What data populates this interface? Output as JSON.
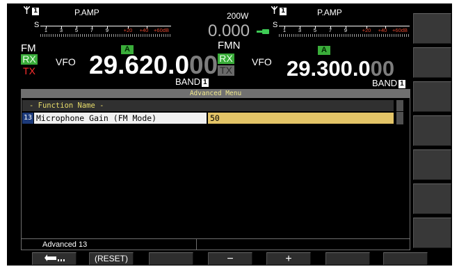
{
  "meter_left": {
    "antenna_number": "1",
    "pamp": "P.AMP",
    "s_letter": "S",
    "scale_labels": [
      "1",
      "3",
      "5",
      "7",
      "9",
      "+20",
      "+40",
      "+60dB"
    ]
  },
  "meter_right": {
    "antenna_number": "1",
    "pamp": "P.AMP",
    "s_letter": "S",
    "scale_labels": [
      "1",
      "3",
      "5",
      "7",
      "9",
      "+20",
      "+40",
      "+60dB"
    ]
  },
  "power": {
    "label": "200W",
    "value": "0.000"
  },
  "vfo_main": {
    "mode": "FM",
    "rx": "RX",
    "tx": "TX",
    "vfo_label": "VFO",
    "a_badge": "A",
    "freq_main": "29.620.0",
    "freq_dim": "00",
    "band_label": "BAND",
    "band_number": "1"
  },
  "vfo_sub": {
    "mode": "FMN",
    "rx": "RX",
    "tx": "TX",
    "vfo_label": "VFO",
    "a_badge": "A",
    "freq_main": "29.300.0",
    "freq_dim": "00",
    "band_label": "BAND",
    "band_number": "1"
  },
  "menu": {
    "title": "Advanced Menu",
    "column_header": "- Function Name -",
    "items": [
      {
        "number": "13",
        "name": "Microphone Gain (FM Mode)",
        "value": "50"
      }
    ],
    "footer_label": "Advanced 13"
  },
  "soft_keys": {
    "back_icon": "return-arrow-icon",
    "reset": "(RESET)",
    "minus": "−",
    "plus": "+"
  },
  "colors": {
    "rx_green": "#3aad3a",
    "value_yellow": "#e3c467",
    "header_yellow": "#e8dd6a",
    "number_blue": "#1c3a7a"
  }
}
